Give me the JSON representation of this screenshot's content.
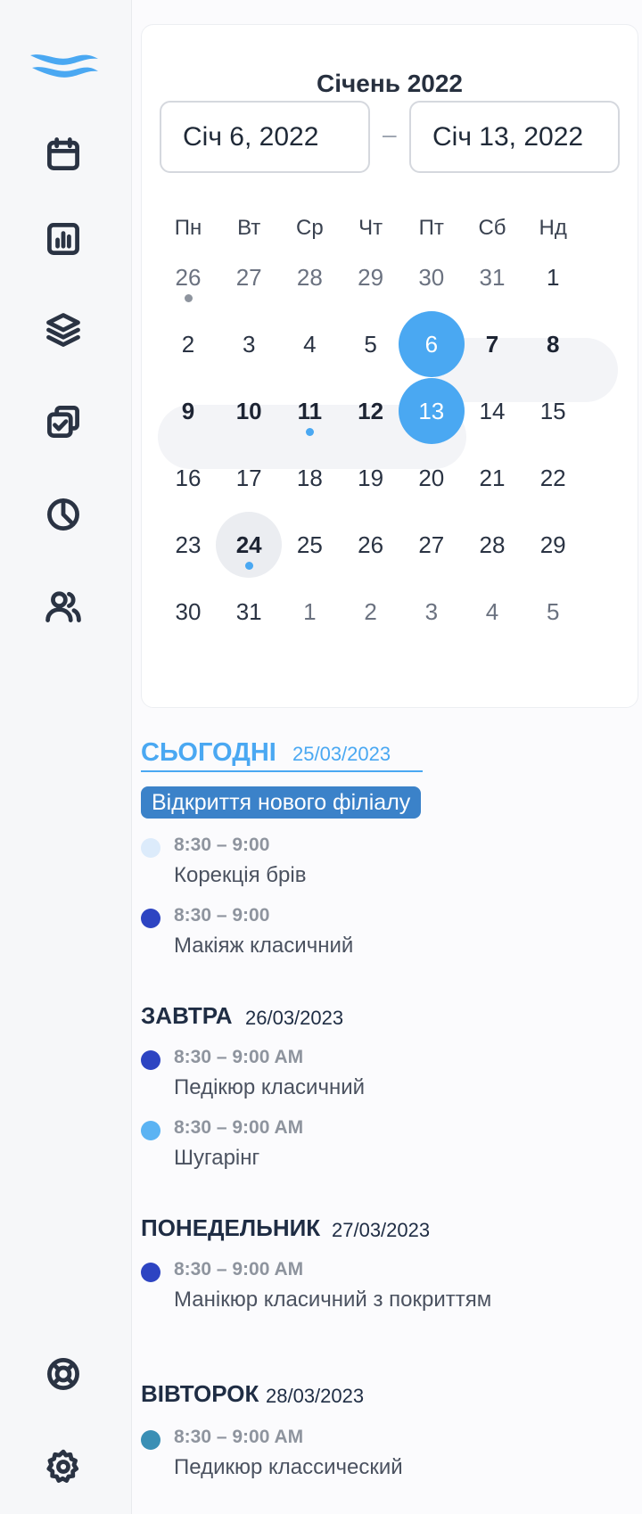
{
  "sidebar": {
    "logo": "wave-logo",
    "nav_icons": [
      "calendar-icon",
      "bar-chart-icon",
      "layers-icon",
      "tasks-icon",
      "pie-chart-icon",
      "users-icon"
    ],
    "bottom_icons": [
      "lifebuoy-icon",
      "gear-icon"
    ]
  },
  "calendar": {
    "title": "Січень 2022",
    "start_date": "Січ 6, 2022",
    "separator": "–",
    "end_date": "Січ 13, 2022",
    "weekdays": [
      "Пн",
      "Вт",
      "Ср",
      "Чт",
      "Пт",
      "Сб",
      "Нд"
    ],
    "weeks": [
      [
        "26",
        "27",
        "28",
        "29",
        "30",
        "31",
        "1"
      ],
      [
        "2",
        "3",
        "4",
        "5",
        "6",
        "7",
        "8"
      ],
      [
        "9",
        "10",
        "11",
        "12",
        "13",
        "14",
        "15"
      ],
      [
        "16",
        "17",
        "18",
        "19",
        "20",
        "21",
        "22"
      ],
      [
        "23",
        "24",
        "25",
        "26",
        "27",
        "28",
        "29"
      ],
      [
        "30",
        "31",
        "1",
        "2",
        "3",
        "4",
        "5"
      ]
    ],
    "selected_start": "6",
    "selected_end": "13",
    "today": "24",
    "accent_color": "#4aa8f2"
  },
  "agenda": {
    "today": {
      "title": "СЬОГОДНІ",
      "date": "25/03/2023",
      "badge": "Відкриття нового філіалу",
      "events": [
        {
          "time": "8:30 – 9:00",
          "name": "Корекція брів",
          "color": "#dcebfb"
        },
        {
          "time": "8:30 – 9:00",
          "name": "Макіяж класичний",
          "color": "#2d44c2"
        }
      ]
    },
    "tomorrow": {
      "title": "ЗАВТРА",
      "date": "26/03/2023",
      "events": [
        {
          "time": "8:30 – 9:00 AM",
          "name": "Педікюр класичний",
          "color": "#2d44c2"
        },
        {
          "time": "8:30 – 9:00 AM",
          "name": "Шугарінг",
          "color": "#5bb3f3"
        }
      ]
    },
    "monday": {
      "title": "ПОНЕДЕЛЬНИК",
      "date": "27/03/2023",
      "events": [
        {
          "time": "8:30 – 9:00 AM",
          "name": "Манікюр класичний з покриттям",
          "color": "#2d44c2"
        }
      ]
    },
    "tuesday": {
      "title": "ВІВТОРОК",
      "date": "28/03/2023",
      "events": [
        {
          "time": "8:30 – 9:00 AM",
          "name": "Педикюр классический",
          "color": "#3a8fb5"
        }
      ]
    }
  }
}
